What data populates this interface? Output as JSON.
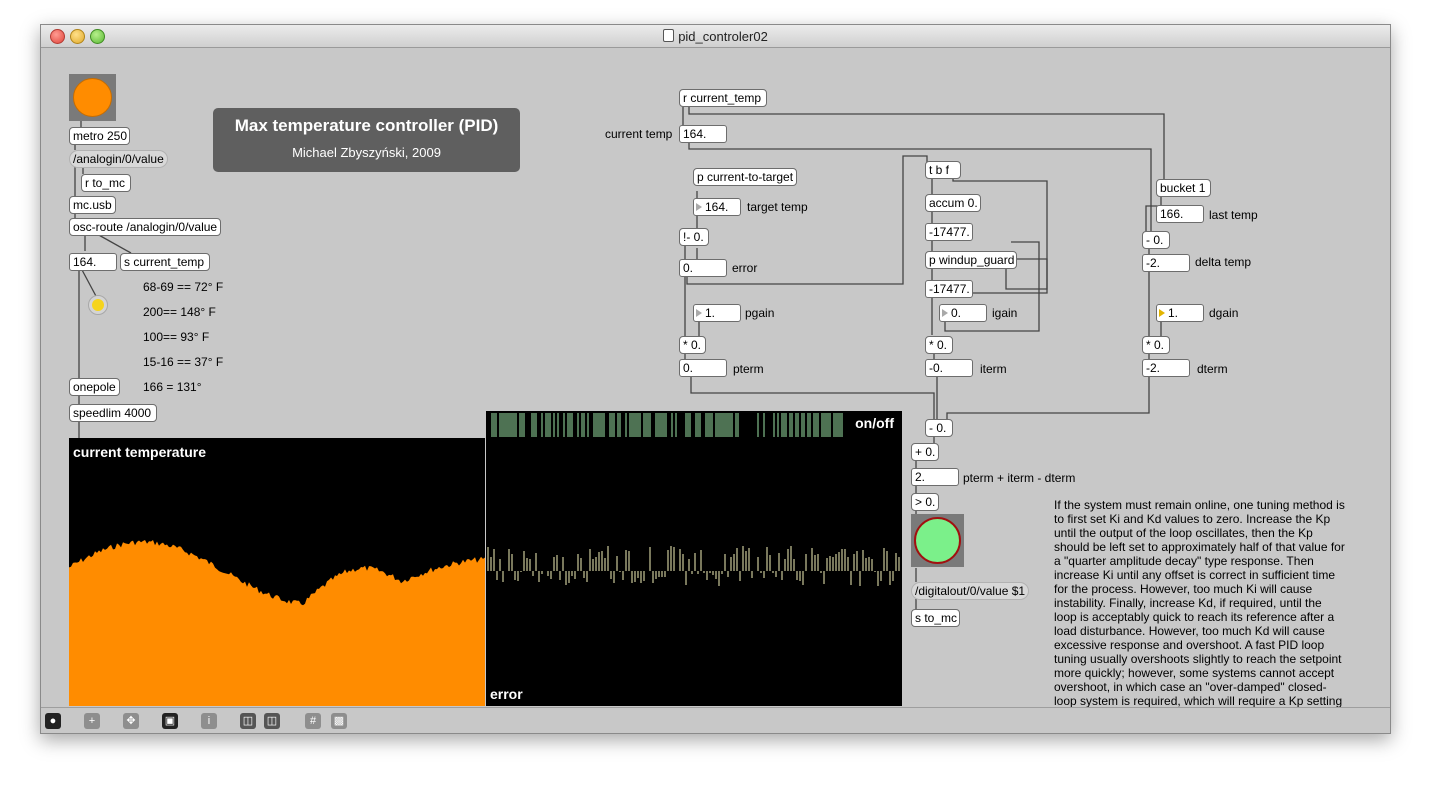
{
  "window": {
    "title": "pid_controler02"
  },
  "panel": {
    "title": "Max temperature controller (PID)",
    "author": "Michael Zbyszyński, 2009"
  },
  "objects": {
    "metro": "metro 250",
    "analogin_msg": "/analogin/0/value",
    "r_to_mc": "r to_mc",
    "mc_usb": "mc.usb",
    "osc_route": "osc-route /analogin/0/value",
    "temp_num": "164.",
    "s_current_temp": "s current_temp",
    "onepole": "onepole",
    "speedlim": "speedlim 4000",
    "r_current_temp": "r current_temp",
    "current_temp_num": "164.",
    "p_current_to_target": "p current-to-target",
    "target_num": "164.",
    "ne": "!- 0.",
    "error_num": "0.",
    "pgain_num": "1.",
    "mul_p": "* 0.",
    "pterm_num": "0.",
    "tbf": "t b f",
    "accum": "accum 0.",
    "accum_num": "-17477.",
    "windup": "p windup_guard",
    "windup_num": "-17477.",
    "igain_num": "0.",
    "mul_i": "* 0.",
    "iterm_num": "-0.",
    "bucket": "bucket 1",
    "last_num": "166.",
    "sub_d": "- 0.",
    "delta_num": "-2.",
    "dgain_num": "1.",
    "mul_d": "* 0.",
    "dterm_num": "-2.",
    "sub2": "- 0.",
    "plus": "+ 0.",
    "sum_num": "2.",
    "gt": "> 0.",
    "digitalout_msg": "/digitalout/0/value $1",
    "s_to_mc": "s to_mc"
  },
  "labels": {
    "calib1": "68-69 == 72° F",
    "calib2": "200== 148° F",
    "calib3": "100== 93° F",
    "calib4": "15-16 == 37° F",
    "calib5": "166 = 131°",
    "current_temp": "current temp",
    "target_temp": "target temp",
    "error": "error",
    "pgain": "pgain",
    "pterm": "pterm",
    "igain": "igain",
    "iterm": "iterm",
    "last_temp": "last temp",
    "delta_temp": "delta temp",
    "dgain": "dgain",
    "dterm": "dterm",
    "sum": "pterm + iterm - dterm"
  },
  "multislider": {
    "label": "current temperature",
    "color": "#ff8c00"
  },
  "grid": {
    "onoff_label": "on/off",
    "error_label": "error",
    "onoff_color": "#9be3a6",
    "error_color": "#f2f0b8"
  },
  "comment": "If the system must remain online, one tuning method is to first set Ki and Kd values to zero. Increase the Kp until the output of the loop oscillates, then the Kp should be left set to approximately half of that value for a \"quarter amplitude decay\" type response. Then increase Ki until any offset is correct in sufficient time for the process. However, too much Ki will cause instability. Finally, increase Kd, if required, until the loop is acceptably quick to reach its reference after a load disturbance. However, too much Kd will cause excessive response and overshoot. A fast PID loop tuning usually overshoots slightly to reach the setpoint more quickly; however, some systems cannot accept overshoot, in which case an \"over-damped\" closed-loop system is required, which will require a Kp setting significantly less than half that of the Kp setting causing oscillation.",
  "colors": {
    "orange": "#ff8c00",
    "led_yellow": "#f5d41c",
    "green_led": "#7bf08a",
    "canvas_bg": "#c8c8c8"
  },
  "toolbar": {
    "lock": "lock-icon",
    "add": "plus-icon",
    "move": "move-icon",
    "presentation": "presentation-icon",
    "info": "info-icon",
    "grid": "grid-icon"
  }
}
